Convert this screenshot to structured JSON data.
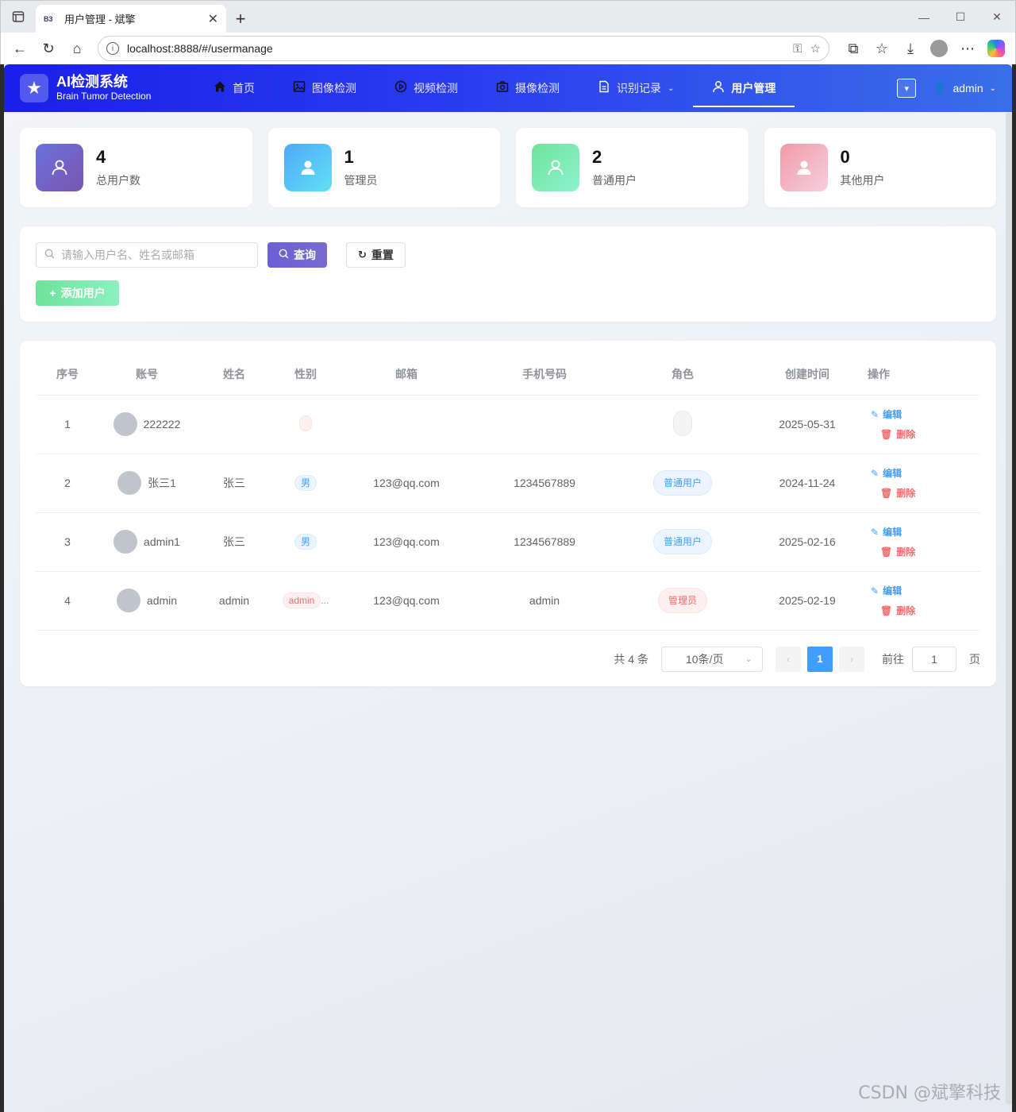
{
  "browser": {
    "tab_title": "用户管理 - 斌擎",
    "tab_favicon": "B3",
    "url": "localhost:8888/#/usermanage"
  },
  "app": {
    "logo_title": "AI检测系统",
    "logo_subtitle": "Brain Tumor Detection",
    "nav": [
      {
        "label": "首页",
        "icon": "home-icon"
      },
      {
        "label": "图像检测",
        "icon": "image-icon"
      },
      {
        "label": "视频检测",
        "icon": "play-circle-icon"
      },
      {
        "label": "摄像检测",
        "icon": "camera-icon"
      },
      {
        "label": "识别记录",
        "icon": "document-icon"
      },
      {
        "label": "用户管理",
        "icon": "user-icon"
      }
    ],
    "active_nav": "用户管理",
    "user": "admin"
  },
  "stats": [
    {
      "value": "4",
      "label": "总用户数",
      "color": "#6a5fd6"
    },
    {
      "value": "1",
      "label": "管理员",
      "color": "#4fb0f5"
    },
    {
      "value": "2",
      "label": "普通用户",
      "color": "#72e2a0"
    },
    {
      "value": "0",
      "label": "其他用户",
      "color": "#f3a3b4"
    }
  ],
  "search": {
    "placeholder": "请输入用户名、姓名或邮箱",
    "query_label": "查询",
    "reset_label": "重置",
    "add_label": "添加用户"
  },
  "table": {
    "columns": [
      "序号",
      "账号",
      "姓名",
      "性别",
      "邮箱",
      "手机号码",
      "角色",
      "创建时间",
      "操作"
    ],
    "rows": [
      {
        "index": "1",
        "account": "222222",
        "name": "",
        "gender": "",
        "email": "",
        "phone": "",
        "role": "",
        "created": "2025-05-31"
      },
      {
        "index": "2",
        "account": "张三1",
        "name": "张三",
        "gender": "男",
        "email": "123@qq.com",
        "phone": "1234567889",
        "role": "普通用户",
        "created": "2024-11-24"
      },
      {
        "index": "3",
        "account": "admin1",
        "name": "张三",
        "gender": "男",
        "email": "123@qq.com",
        "phone": "1234567889",
        "role": "普通用户",
        "created": "2025-02-16"
      },
      {
        "index": "4",
        "account": "admin",
        "name": "admin",
        "gender": "admin",
        "gender_more": "...",
        "email": "123@qq.com",
        "phone": "admin",
        "role": "管理员",
        "created": "2025-02-19"
      }
    ],
    "edit_label": "编辑",
    "delete_label": "删除"
  },
  "pagination": {
    "total": "共 4 条",
    "page_size": "10条/页",
    "current": "1",
    "goto_label": "前往",
    "goto_value": "1",
    "page_suffix": "页"
  },
  "watermark": "CSDN @斌擎科技"
}
